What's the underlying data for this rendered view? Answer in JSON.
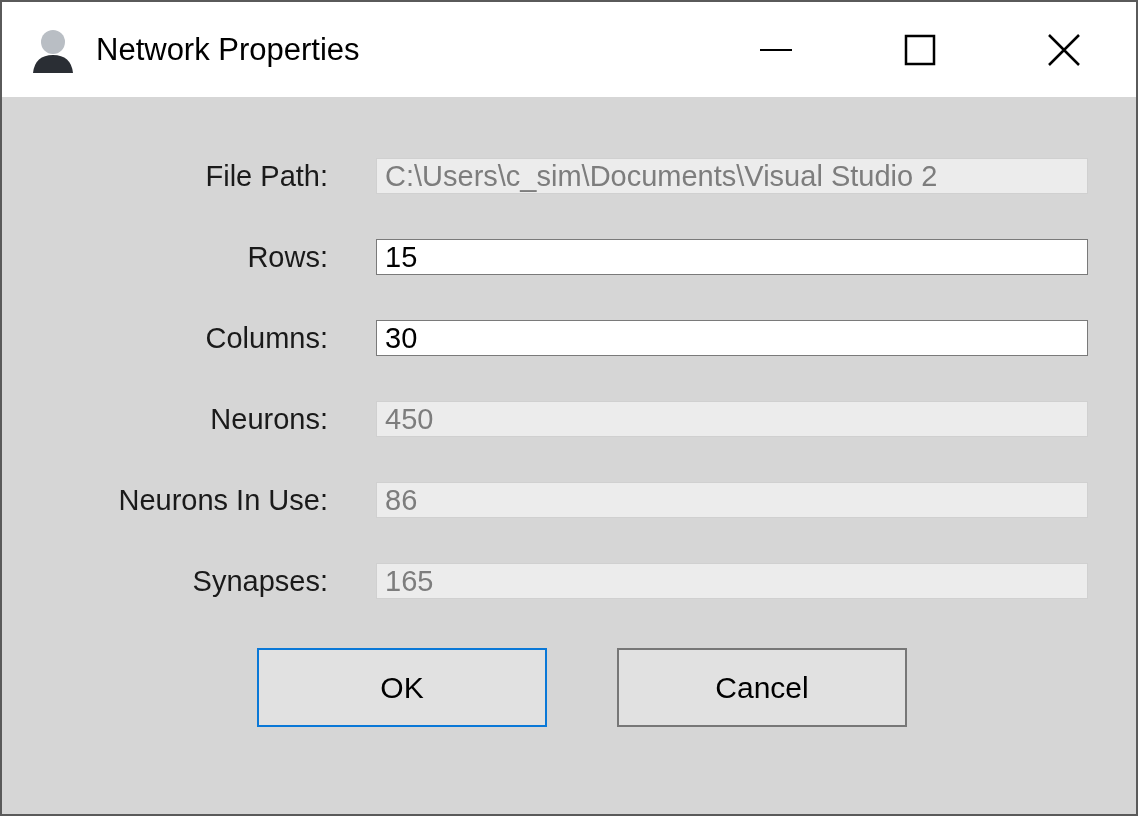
{
  "window": {
    "title": "Network Properties"
  },
  "fields": [
    {
      "label": "File Path:",
      "value": "C:\\Users\\c_sim\\Documents\\Visual Studio 2",
      "disabled": true
    },
    {
      "label": "Rows:",
      "value": "15",
      "disabled": false
    },
    {
      "label": "Columns:",
      "value": "30",
      "disabled": false
    },
    {
      "label": "Neurons:",
      "value": "450",
      "disabled": true
    },
    {
      "label": "Neurons In Use:",
      "value": "86",
      "disabled": true
    },
    {
      "label": "Synapses:",
      "value": "165",
      "disabled": true
    }
  ],
  "buttons": [
    {
      "label": "OK",
      "default": true
    },
    {
      "label": "Cancel",
      "default": false
    }
  ]
}
